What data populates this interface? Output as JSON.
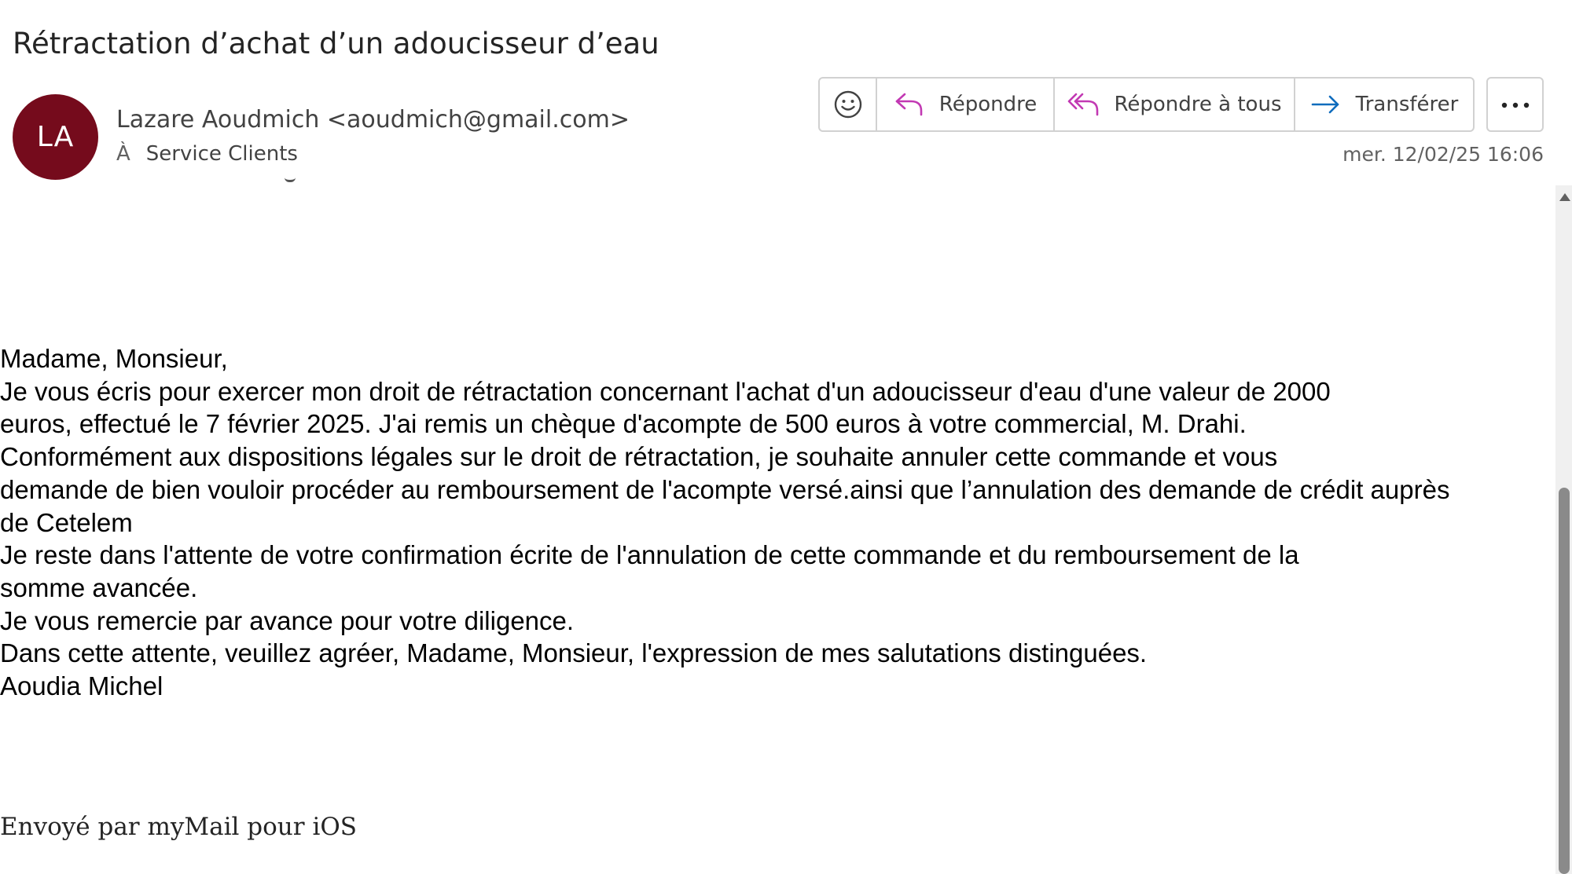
{
  "email": {
    "subject": "Rétractation d’achat d’un adoucisseur d’eau",
    "sender": {
      "initials": "LA",
      "display": "Lazare Aoudmich <aoudmich@gmail.com>",
      "avatar_color": "#750b1c"
    },
    "recipient": {
      "label": "À",
      "name": "Service Clients"
    },
    "date": "mer. 12/02/25 16:06",
    "body_lines": [
      "Madame, Monsieur,",
      "Je vous écris pour exercer mon droit de rétractation concernant l'achat d'un adoucisseur d'eau d'une valeur de 2000",
      "euros, effectué le 7 février 2025. J'ai remis un chèque d'acompte de 500 euros à votre commercial, M. Drahi.",
      "Conformément aux dispositions légales sur le droit de rétractation, je souhaite annuler cette commande et vous",
      "demande de bien vouloir procéder au remboursement de l'acompte versé.ainsi que l’annulation des demande de crédit auprès",
      "de Cetelem",
      "Je reste dans l'attente de votre confirmation écrite de l'annulation de cette commande et du remboursement de la",
      "somme avancée.",
      "Je vous remercie par avance pour votre diligence.",
      "Dans cette attente, veuillez agréer, Madame, Monsieur, l'expression de mes salutations distinguées.",
      "Aoudia Michel"
    ],
    "signature": "Envoyé par myMail pour iOS"
  },
  "toolbar": {
    "emoji_icon": "smiley-icon",
    "reply_label": "Répondre",
    "reply_all_label": "Répondre à tous",
    "forward_label": "Transférer",
    "more_icon": "more-dots-icon",
    "colors": {
      "reply_icon": "#c239b3",
      "reply_all_icon": "#c239b3",
      "forward_icon": "#0f6cbd"
    }
  }
}
